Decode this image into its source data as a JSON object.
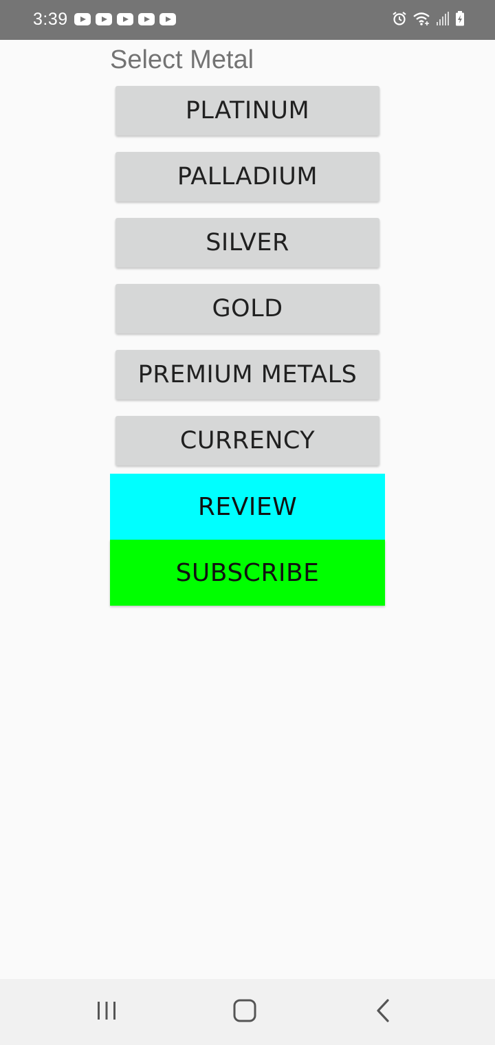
{
  "status_bar": {
    "time": "3:39",
    "notification_icons": [
      "youtube-icon",
      "youtube-icon",
      "youtube-icon",
      "youtube-icon",
      "youtube-icon"
    ],
    "system_icons": [
      "alarm-icon",
      "wifi-icon",
      "signal-icon",
      "battery-charging-icon"
    ]
  },
  "screen": {
    "title": "Select Metal",
    "metal_buttons": [
      "PLATINUM",
      "PALLADIUM",
      "SILVER",
      "GOLD",
      "PREMIUM METALS",
      "CURRENCY"
    ],
    "review_label": "REVIEW",
    "subscribe_label": "SUBSCRIBE",
    "colors": {
      "review": "#00ffff",
      "subscribe": "#00ff00",
      "button": "#d6d7d7"
    }
  },
  "nav_bar": {
    "icons": [
      "recents-icon",
      "home-icon",
      "back-icon"
    ]
  }
}
